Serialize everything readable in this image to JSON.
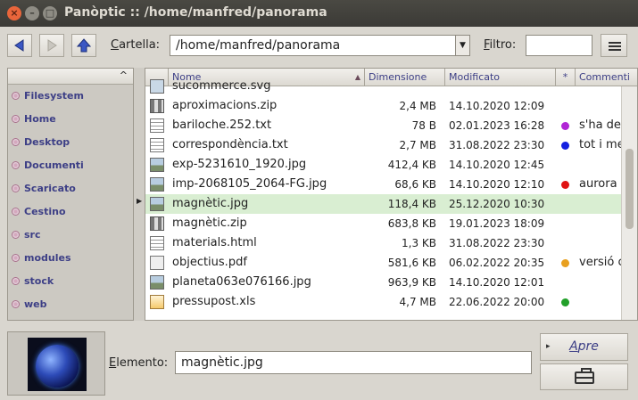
{
  "window": {
    "title": "Panòptic :: /home/manfred/panorama",
    "close_glyph": "×",
    "minimize_glyph": "–",
    "maximize_glyph": "□"
  },
  "toolbar": {
    "back_icon": "arrow-left-icon",
    "forward_icon": "arrow-right-icon",
    "up_icon": "arrow-up-icon",
    "folder_label_underlined": "C",
    "folder_label_rest": "artella:",
    "path_value": "/home/manfred/panorama",
    "filter_label_underlined": "F",
    "filter_label_rest": "iltro:",
    "filter_value": "",
    "menu_icon": "hamburger-menu-icon"
  },
  "sidebar": {
    "header": "",
    "items": [
      {
        "label": "Filesystem"
      },
      {
        "label": "Home"
      },
      {
        "label": "Desktop"
      },
      {
        "label": "Documenti"
      },
      {
        "label": "Scaricato"
      },
      {
        "label": "Cestino"
      },
      {
        "label": "src"
      },
      {
        "label": "modules"
      },
      {
        "label": "stock"
      },
      {
        "label": "web"
      }
    ]
  },
  "filelist": {
    "columns": {
      "name": "Nome",
      "size": "Dimensione",
      "modified": "Modificato",
      "tag": "*",
      "comment": "Commenti"
    },
    "selected_index": 6,
    "rows": [
      {
        "name": "sucommerce.svg",
        "size": "",
        "date": "",
        "dot": "",
        "comment": "",
        "icon": "svg-icon"
      },
      {
        "name": "aproximacions.zip",
        "size": "2,4 MB",
        "date": "14.10.2020 12:09",
        "dot": "",
        "comment": "",
        "icon": "zip-icon"
      },
      {
        "name": "bariloche.252.txt",
        "size": "78 B",
        "date": "02.01.2023 16:28",
        "dot": "#b126d6",
        "comment": "s'ha de",
        "icon": "text-icon"
      },
      {
        "name": "correspondència.txt",
        "size": "2,7 MB",
        "date": "31.08.2022 23:30",
        "dot": "#1420e0",
        "comment": "tot i me",
        "icon": "text-icon"
      },
      {
        "name": "exp-5231610_1920.jpg",
        "size": "412,4 KB",
        "date": "14.10.2020 12:45",
        "dot": "",
        "comment": "",
        "icon": "image-icon"
      },
      {
        "name": "imp-2068105_2064-FG.jpg",
        "size": "68,6 KB",
        "date": "14.10.2020 12:10",
        "dot": "#e01414",
        "comment": "aurora",
        "icon": "image-icon"
      },
      {
        "name": "magnètic.jpg",
        "size": "118,4 KB",
        "date": "25.12.2020 10:30",
        "dot": "",
        "comment": "",
        "icon": "image-icon"
      },
      {
        "name": "magnètic.zip",
        "size": "683,8 KB",
        "date": "19.01.2023 18:09",
        "dot": "",
        "comment": "",
        "icon": "zip-icon"
      },
      {
        "name": "materials.html",
        "size": "1,3 KB",
        "date": "31.08.2022 23:30",
        "dot": "",
        "comment": "",
        "icon": "text-icon"
      },
      {
        "name": "objectius.pdf",
        "size": "581,6 KB",
        "date": "06.02.2022 20:35",
        "dot": "#e8a020",
        "comment": "versió c",
        "icon": "pdf-icon"
      },
      {
        "name": "planeta063e076166.jpg",
        "size": "963,9 KB",
        "date": "14.10.2020 12:01",
        "dot": "",
        "comment": "",
        "icon": "image-icon"
      },
      {
        "name": "pressupost.xls",
        "size": "4,7 MB",
        "date": "22.06.2022 20:00",
        "dot": "#22a02a",
        "comment": "",
        "icon": "spreadsheet-icon"
      }
    ]
  },
  "bottom": {
    "element_label_underlined": "E",
    "element_label_rest": "lemento:",
    "element_value": "magnètic.jpg",
    "open_label_underlined": "A",
    "open_label_rest": "pre",
    "open_arrow": "▸",
    "briefcase_icon": "briefcase-icon",
    "preview_icon": "planet-thumbnail-icon"
  },
  "colors": {
    "selection": "#d9eed2",
    "link_text": "#3d3f86",
    "title_bar": "#3b3a36",
    "close_button": "#e9653b"
  }
}
